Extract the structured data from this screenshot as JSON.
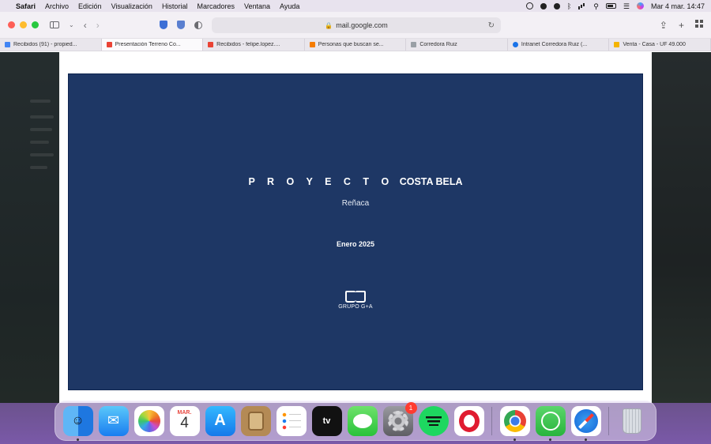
{
  "menubar": {
    "apple_icon": "apple-logo-icon",
    "items": [
      "Safari",
      "Archivo",
      "Edición",
      "Visualización",
      "Historial",
      "Marcadores",
      "Ventana",
      "Ayuda"
    ],
    "clock": "Mar 4 mar.  14:47"
  },
  "toolbar": {
    "url": "mail.google.com"
  },
  "tabs": [
    {
      "label": "Recibidos (91) - propied...",
      "favicon_color": "#4285f4"
    },
    {
      "label": "Presentación Terreno Co...",
      "favicon_color": "#ea4335"
    },
    {
      "label": "Recibidos - felipe.lopez....",
      "favicon_color": "#ea4335"
    },
    {
      "label": "Personas que buscan se...",
      "favicon_color": "#f57c00"
    },
    {
      "label": "Corredora Ruiz",
      "favicon_color": "#9aa0a6"
    },
    {
      "label": "Intranet Corredora Ruiz (...",
      "favicon_color": "#1a73e8"
    },
    {
      "label": "Venta - Casa - UF 49.000",
      "favicon_color": "#f4b400"
    }
  ],
  "slide": {
    "title_spaced": "P R O Y E C T O",
    "title_name": "COSTA BELA",
    "subtitle": "Reñaca",
    "date": "Enero  2025",
    "logo_label": "GRUPO G+A",
    "background_color": "#1e3765"
  },
  "dock": {
    "calendar_month": "MAR.",
    "calendar_day": "4",
    "tv_label": "tv",
    "settings_badge": "1"
  }
}
